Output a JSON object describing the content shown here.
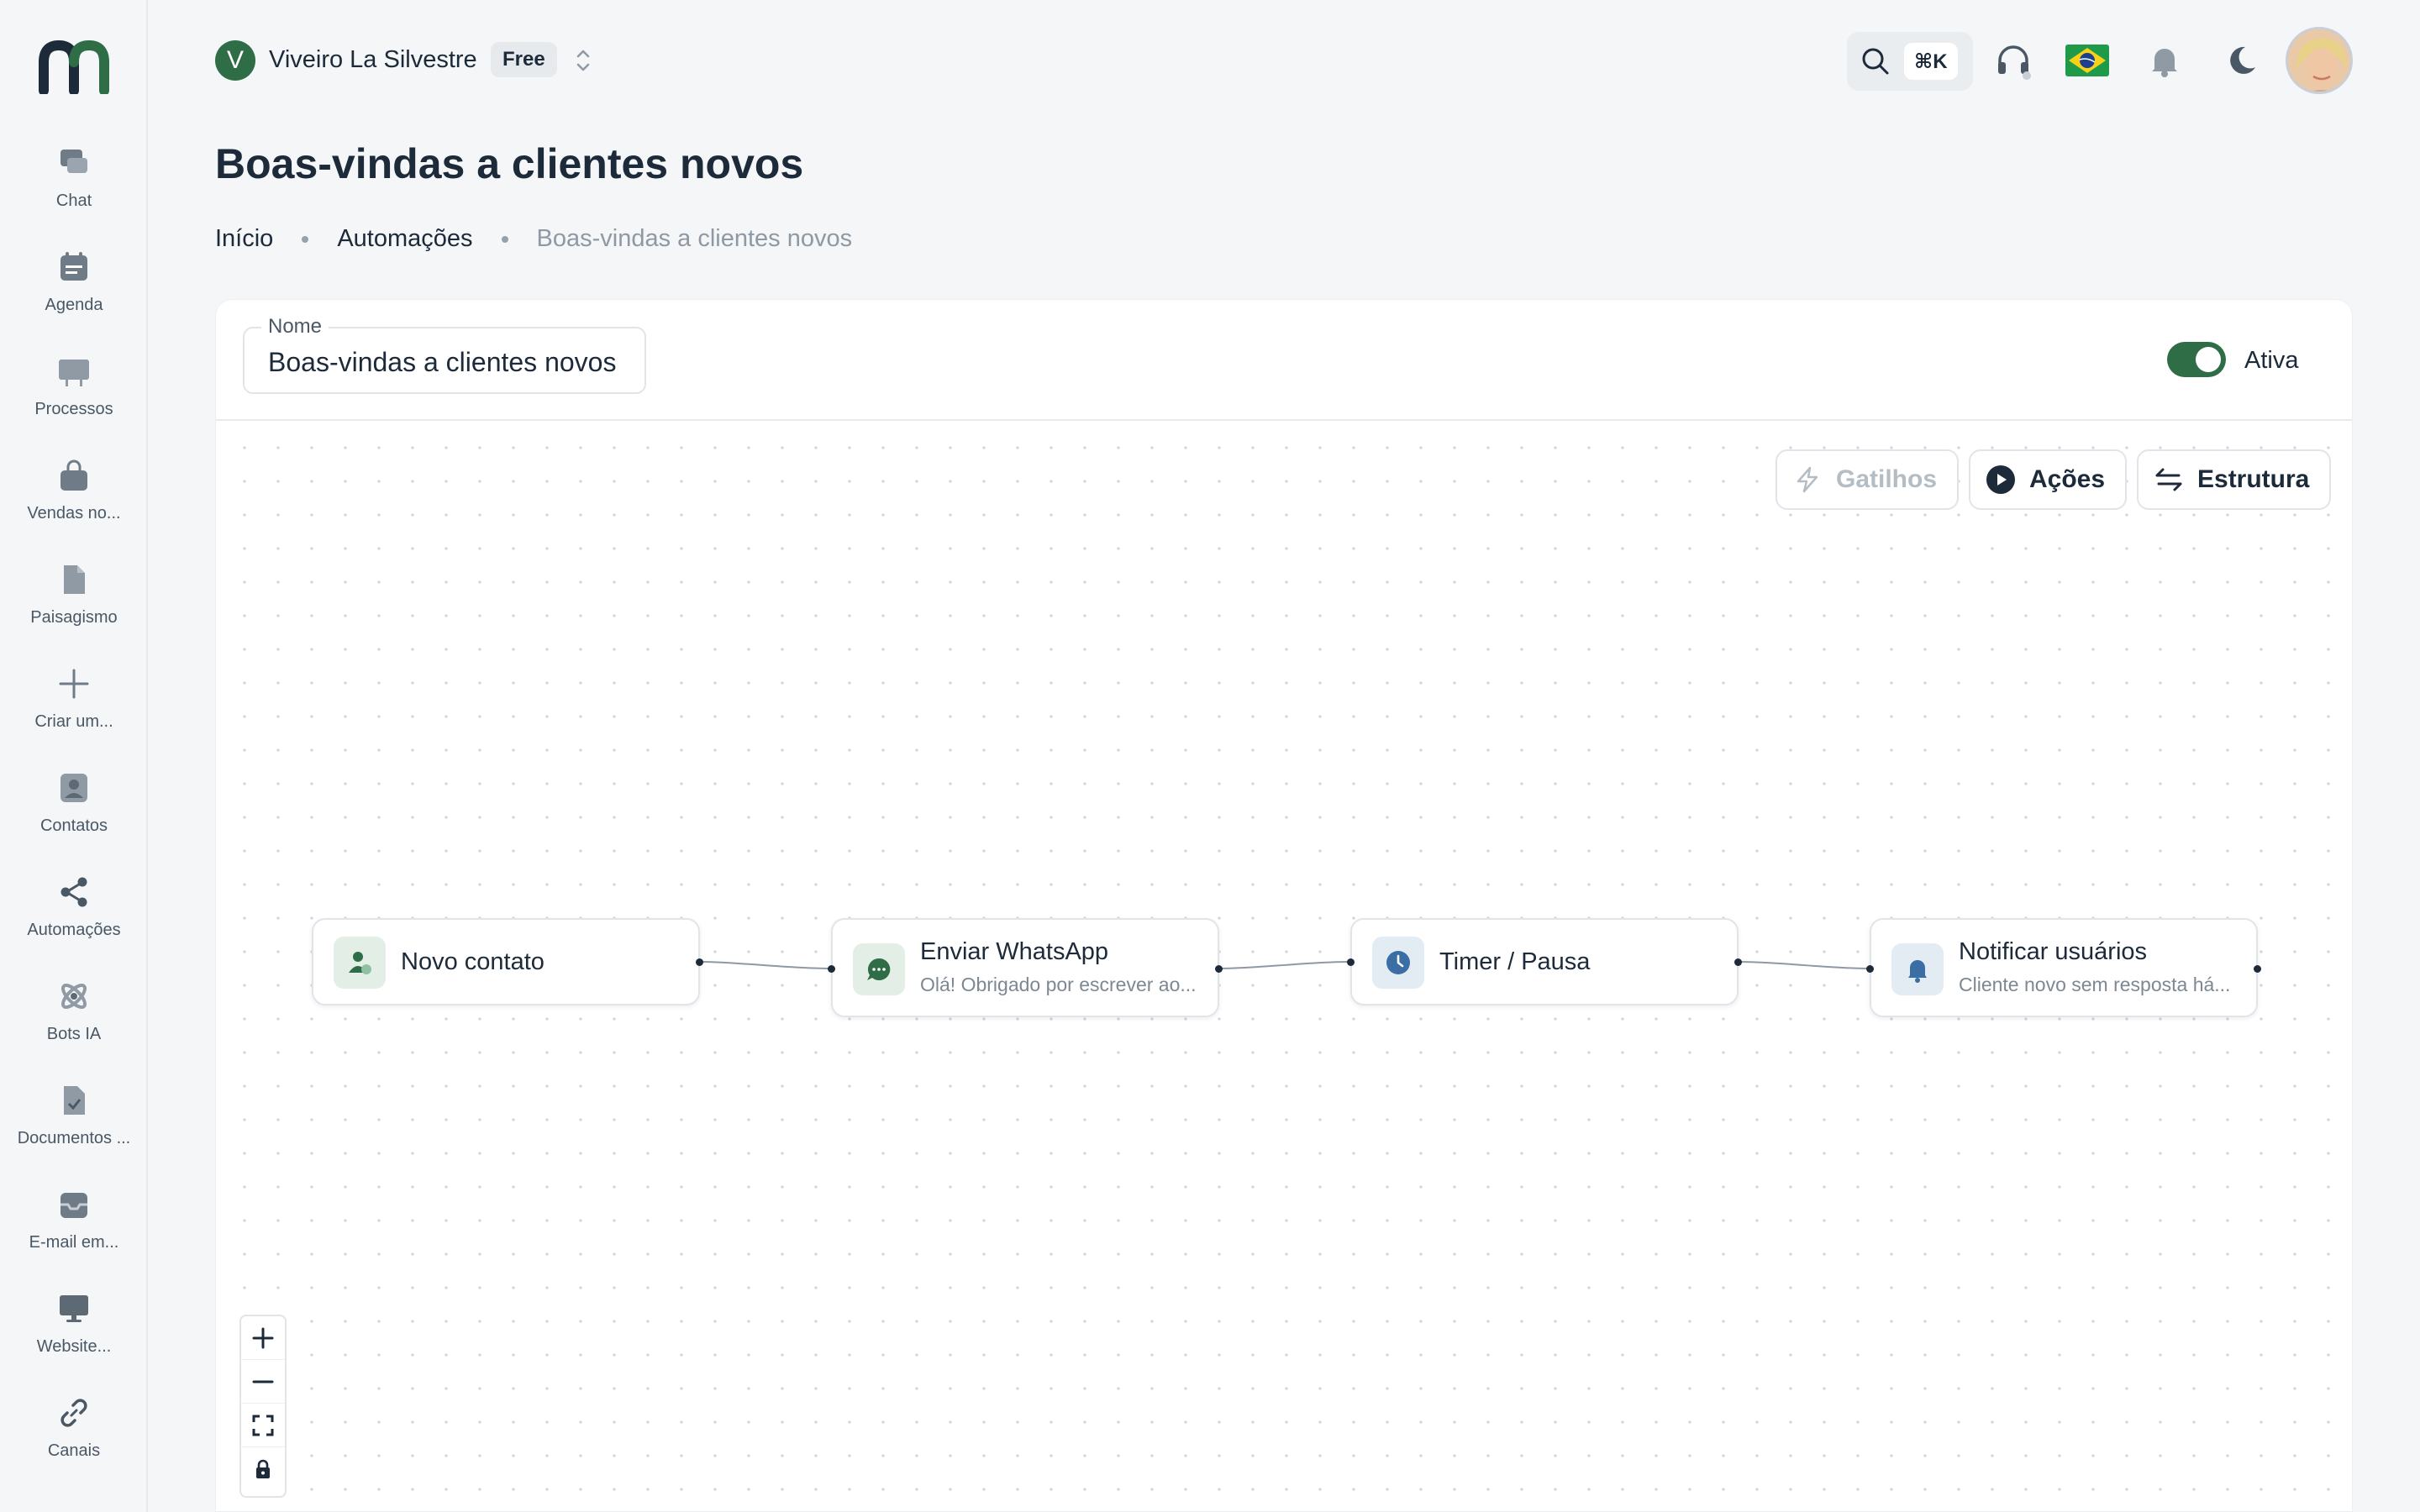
{
  "sidebar": {
    "items": [
      {
        "label": "Chat",
        "icon": "chat-icon"
      },
      {
        "label": "Agenda",
        "icon": "calendar-icon"
      },
      {
        "label": "Processos",
        "icon": "board-icon"
      },
      {
        "label": "Vendas no...",
        "icon": "shopping-bag-icon"
      },
      {
        "label": "Paisagismo",
        "icon": "document-icon"
      },
      {
        "label": "Criar um...",
        "icon": "plus-icon"
      },
      {
        "label": "Contatos",
        "icon": "contact-icon"
      },
      {
        "label": "Automações",
        "icon": "share-nodes-icon"
      },
      {
        "label": "Bots IA",
        "icon": "atom-icon"
      },
      {
        "label": "Documentos ...",
        "icon": "file-check-icon"
      },
      {
        "label": "E-mail em...",
        "icon": "inbox-icon"
      },
      {
        "label": "Website...",
        "icon": "monitor-icon"
      },
      {
        "label": "Canais",
        "icon": "link-icon"
      }
    ]
  },
  "header": {
    "workspace_initial": "V",
    "workspace_name": "Viveiro La Silvestre",
    "plan": "Free",
    "search_shortcut": "⌘K",
    "colors": {
      "brand": "#2f6d47",
      "text": "#1c2a3a"
    }
  },
  "page": {
    "title": "Boas-vindas a clientes novos",
    "breadcrumb": [
      "Início",
      "Automações",
      "Boas-vindas a clientes novos"
    ]
  },
  "form": {
    "name_label": "Nome",
    "name_value": "Boas-vindas a clientes novos",
    "active_label": "Ativa",
    "active": true
  },
  "toolbar": {
    "triggers": "Gatilhos",
    "actions": "Ações",
    "structure": "Estrutura"
  },
  "flow": {
    "nodes": [
      {
        "title": "Novo contato",
        "subtitle": "",
        "icon": "contact-add-icon"
      },
      {
        "title": "Enviar WhatsApp",
        "subtitle": "Olá! Obrigado por escrever ao...",
        "icon": "chat-bubble-icon"
      },
      {
        "title": "Timer / Pausa",
        "subtitle": "",
        "icon": "clock-icon"
      },
      {
        "title": "Notificar usuários",
        "subtitle": "Cliente novo sem resposta há...",
        "icon": "bell-icon"
      }
    ]
  }
}
